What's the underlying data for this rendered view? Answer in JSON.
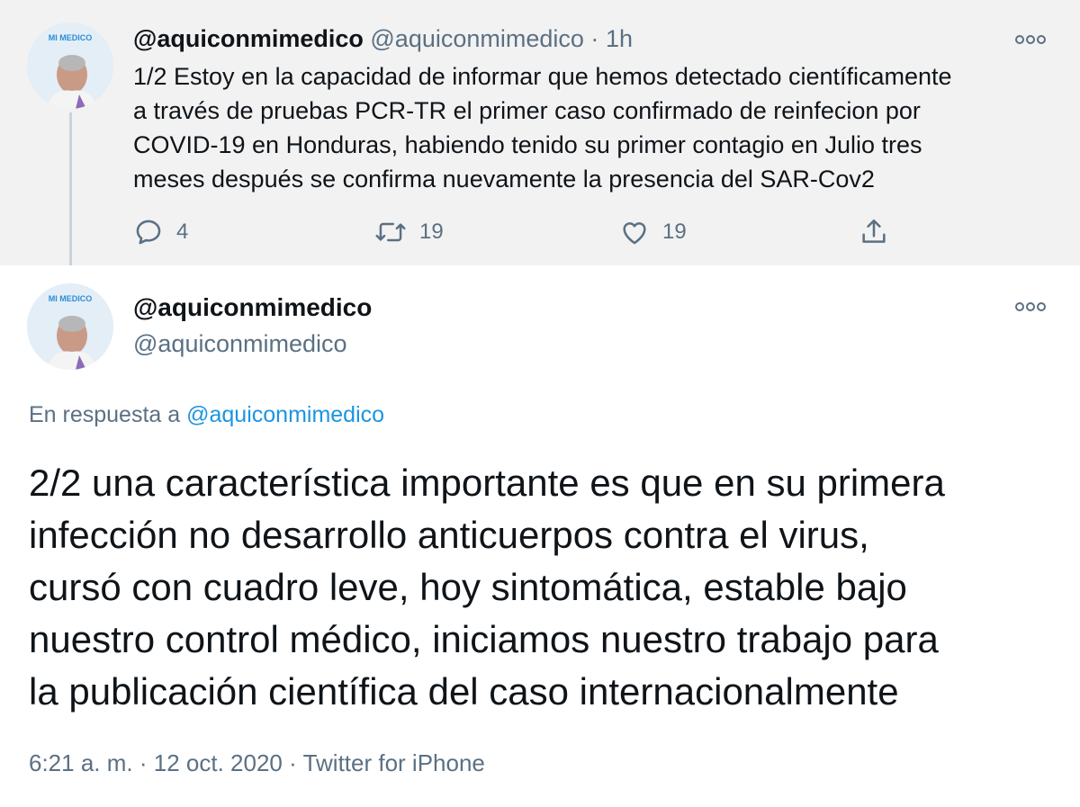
{
  "parent_tweet": {
    "display_name": "@aquiconmimedico",
    "handle": "@aquiconmimedico",
    "separator": "·",
    "time": "1h",
    "text_lines": [
      "1/2 Estoy en la capacidad de informar que hemos detectado científicamente",
      "a través de pruebas PCR-TR el primer caso confirmado de reinfecion por",
      "COVID-19 en Honduras, habiendo tenido su primer contagio en Julio  tres",
      "meses después se confirma nuevamente la presencia del SAR-Cov2"
    ],
    "actions": {
      "reply_count": "4",
      "retweet_count": "19",
      "like_count": "19"
    },
    "avatar_logo_text": "MI MEDICO"
  },
  "main_tweet": {
    "display_name": "@aquiconmimedico",
    "handle": "@aquiconmimedico",
    "reply_prefix": "En respuesta a",
    "reply_to": "@aquiconmimedico",
    "text_lines": [
      "2/2 una característica importante es que en su primera",
      "infección no desarrollo anticuerpos contra el virus,",
      "cursó con cuadro leve, hoy sintomática, estable bajo",
      "nuestro control médico, iniciamos nuestro trabajo para",
      "la publicación científica del caso internacionalmente"
    ],
    "time": "6:21 a. m.",
    "date": "12 oct. 2020",
    "source": "Twitter for iPhone",
    "separator": "·",
    "avatar_logo_text": "MI MEDICO"
  },
  "colors": {
    "parent_background": "#f2f2f2",
    "text_primary": "#0f1419",
    "text_secondary": "#5b7083",
    "link": "#1b95e0",
    "thread_line": "#c9d3dc"
  },
  "icons": [
    "avatar-photo",
    "more-options-icon",
    "reply-icon",
    "retweet-icon",
    "like-icon",
    "share-icon"
  ]
}
